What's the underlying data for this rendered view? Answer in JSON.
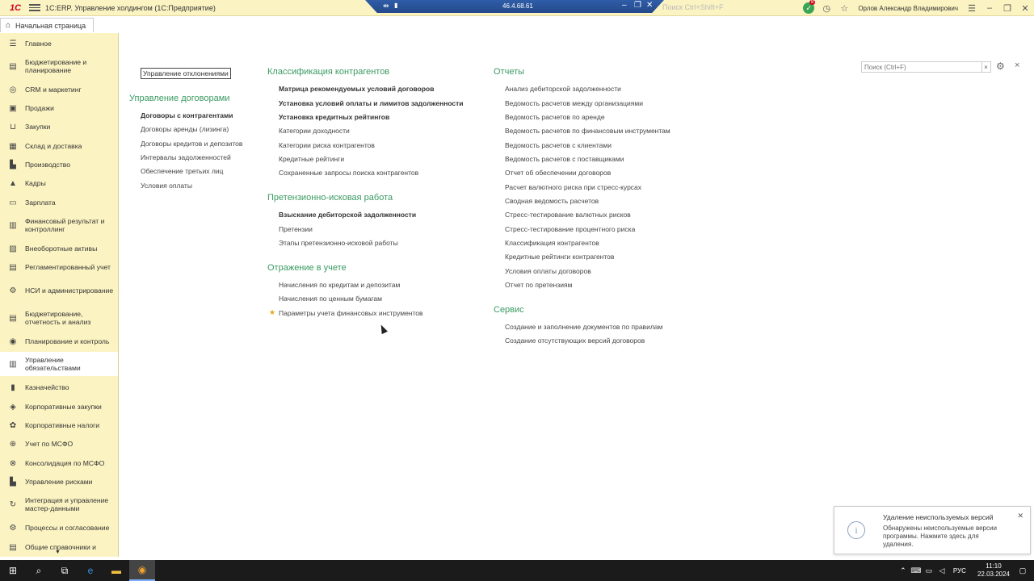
{
  "titlebar": {
    "app_title": "1С:ERP. Управление холдингом  (1С:Предприятие)",
    "remote_ip": "46.4.68.61",
    "search_placeholder": "Поиск Ctrl+Shift+F",
    "notification_count": "8",
    "user": "Орлов Александр Владимирович"
  },
  "tabs": {
    "home": "Начальная страница"
  },
  "sidebar": {
    "items": [
      {
        "label": "Главное",
        "icon": "menu-icon"
      },
      {
        "label": "Бюджетирование и планирование",
        "icon": "budget-icon"
      },
      {
        "label": "CRM и маркетинг",
        "icon": "crm-icon"
      },
      {
        "label": "Продажи",
        "icon": "sales-icon"
      },
      {
        "label": "Закупки",
        "icon": "cart-icon"
      },
      {
        "label": "Склад и доставка",
        "icon": "warehouse-icon"
      },
      {
        "label": "Производство",
        "icon": "factory-icon"
      },
      {
        "label": "Кадры",
        "icon": "personnel-icon"
      },
      {
        "label": "Зарплата",
        "icon": "salary-icon"
      },
      {
        "label": "Финансовый результат и контроллинг",
        "icon": "chart-icon"
      },
      {
        "label": "Внеоборотные активы",
        "icon": "assets-icon"
      },
      {
        "label": "Регламентированный учет",
        "icon": "ledger-icon"
      },
      {
        "label": "НСИ и администрирование",
        "icon": "gear-icon"
      },
      {
        "label": "Бюджетирование, отчетность и анализ",
        "icon": "report-icon"
      },
      {
        "label": "Планирование и контроль",
        "icon": "plan-icon"
      },
      {
        "label": "Управление обязательствами",
        "icon": "obligations-icon"
      },
      {
        "label": "Казначейство",
        "icon": "treasury-icon"
      },
      {
        "label": "Корпоративные закупки",
        "icon": "corp-purchase-icon"
      },
      {
        "label": "Корпоративные налоги",
        "icon": "tax-icon"
      },
      {
        "label": "Учет по МСФО",
        "icon": "ifrs-icon"
      },
      {
        "label": "Консолидация по МСФО",
        "icon": "consolidation-icon"
      },
      {
        "label": "Управление рисками",
        "icon": "risk-icon"
      },
      {
        "label": "Интеграция и управление мастер-данными",
        "icon": "integration-icon"
      },
      {
        "label": "Процессы и согласование",
        "icon": "process-icon"
      },
      {
        "label": "Общие справочники и",
        "icon": "catalog-icon"
      }
    ]
  },
  "main": {
    "search_placeholder": "Поиск (Ctrl+F)",
    "deviation_link": "Управление отклонениями",
    "contracts": {
      "title": "Управление договорами",
      "items": [
        "Договоры с контрагентами",
        "Договоры аренды (лизинга)",
        "Договоры кредитов и депозитов",
        "Интервалы задолженностей",
        "Обеспечение третьих лиц",
        "Условия оплаты"
      ]
    },
    "classification": {
      "title": "Классификация контрагентов",
      "items": [
        "Матрица рекомендуемых условий договоров",
        "Установка условий оплаты и лимитов задолженности",
        "Установка кредитных рейтингов",
        "Категории доходности",
        "Категории риска контрагентов",
        "Кредитные рейтинги",
        "Сохраненные запросы поиска контрагентов"
      ]
    },
    "claims": {
      "title": "Претензионно-исковая работа",
      "items": [
        "Взыскание дебиторской задолженности",
        "Претензии",
        "Этапы претензионно-исковой работы"
      ]
    },
    "accounting": {
      "title": "Отражение в учете",
      "items": [
        "Начисления по кредитам и депозитам",
        "Начисления по ценным бумагам",
        "Параметры учета финансовых инструментов"
      ]
    },
    "reports": {
      "title": "Отчеты",
      "items": [
        "Анализ дебиторской задолженности",
        "Ведомость расчетов между организациями",
        "Ведомость расчетов по аренде",
        "Ведомость расчетов по финансовым инструментам",
        "Ведомость расчетов с клиентами",
        "Ведомость расчетов с поставщиками",
        "Отчет об обеспечении договоров",
        "Расчет валютного риска при стресс-курсах",
        "Сводная ведомость расчетов",
        "Стресс-тестирование валютных рисков",
        "Стресс-тестирование процентного риска",
        "Классификация контрагентов",
        "Кредитные рейтинги контрагентов",
        "Условия оплаты договоров",
        "Отчет по претензиям"
      ]
    },
    "service": {
      "title": "Сервис",
      "items": [
        "Создание и заполнение документов по правилам",
        "Создание отсутствующих версий договоров"
      ]
    }
  },
  "toast": {
    "title": "Удаление неиспользуемых версий",
    "text": "Обнаружены неиспользуемые версии программы. Нажмите здесь для удаления."
  },
  "taskbar": {
    "lang": "РУС",
    "time": "11:10",
    "date": "22.03.2024"
  },
  "colors": {
    "accent_green": "#3a9a62",
    "sidebar_bg": "#fbf3c2"
  }
}
